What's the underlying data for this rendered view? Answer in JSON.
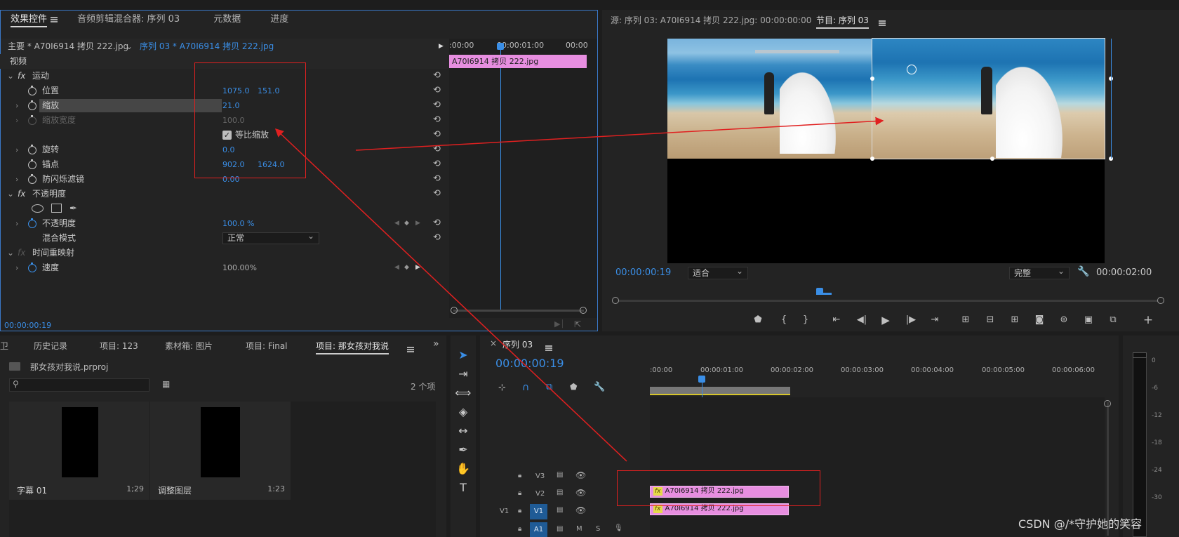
{
  "effect_controls": {
    "tabs": [
      "效果控件",
      "音频剪辑混合器: 序列 03",
      "元数据",
      "进度"
    ],
    "master_clip": "主要 * A70I6914 拷贝 222.jpg",
    "sequence_clip": "序列 03 * A70I6914 拷贝 222.jpg",
    "section_video": "视频",
    "motion": "运动",
    "position_label": "位置",
    "position_x": "1075.0",
    "position_y": "151.0",
    "scale_label": "缩放",
    "scale_value": "21.0",
    "scale_width_label": "缩放宽度",
    "scale_width_value": "100.0",
    "uniform_scale": "等比缩放",
    "rotation_label": "旋转",
    "rotation_value": "0.0",
    "anchor_label": "锚点",
    "anchor_x": "902.0",
    "anchor_y": "1624.0",
    "antiflicker_label": "防闪烁滤镜",
    "antiflicker_value": "0.00",
    "opacity_group": "不透明度",
    "opacity_label": "不透明度",
    "opacity_value": "100.0 %",
    "blend_label": "混合模式",
    "blend_value": "正常",
    "time_remap": "时间重映射",
    "speed_label": "速度",
    "speed_value": "100.00%",
    "timecode": "00:00:00:19",
    "mini_ruler": [
      ":00:00",
      "00:00:01:00",
      "00:00"
    ],
    "mini_clip": "A70I6914 拷贝 222.jpg"
  },
  "source_monitor": {
    "title": "源: 序列 03: A70I6914 拷贝 222.jpg: 00:00:00:00"
  },
  "program_monitor": {
    "title": "节目: 序列 03",
    "timecode": "00:00:00:19",
    "fit": "适合",
    "quality": "完整",
    "duration": "00:00:02:00"
  },
  "project": {
    "tabs": [
      "历史记录",
      "项目: 123",
      "素材箱: 图片",
      "项目: Final",
      "项目: 那女孩对我说"
    ],
    "file": "那女孩对我说.prproj",
    "search_placeholder": "",
    "item_count": "2 个项",
    "items": [
      {
        "name": "字幕 01",
        "duration": "1;29"
      },
      {
        "name": "调整图层",
        "duration": "1:23"
      }
    ]
  },
  "timeline": {
    "title": "序列 03",
    "timecode": "00:00:00:19",
    "ruler": [
      ":00:00",
      "00:00:01:00",
      "00:00:02:00",
      "00:00:03:00",
      "00:00:04:00",
      "00:00:05:00",
      "00:00:06:00"
    ],
    "tracks": [
      "V3",
      "V2",
      "V1",
      "A1"
    ],
    "source_patch": "V1",
    "a1_m": "M",
    "a1_s": "S",
    "clip_v2": "A70I6914 拷贝 222.jpg",
    "clip_v1": "A70I6914 拷贝 222.jpg",
    "fx_badge": "fx"
  },
  "meter": {
    "labels": [
      "0",
      "-6",
      "-12",
      "-18",
      "-24",
      "-30"
    ]
  },
  "watermark": "CSDN @/*守护她的笑容",
  "colors": {
    "accent": "#3a8ee6",
    "clip": "#e78ee0",
    "annotation": "#e02020"
  }
}
